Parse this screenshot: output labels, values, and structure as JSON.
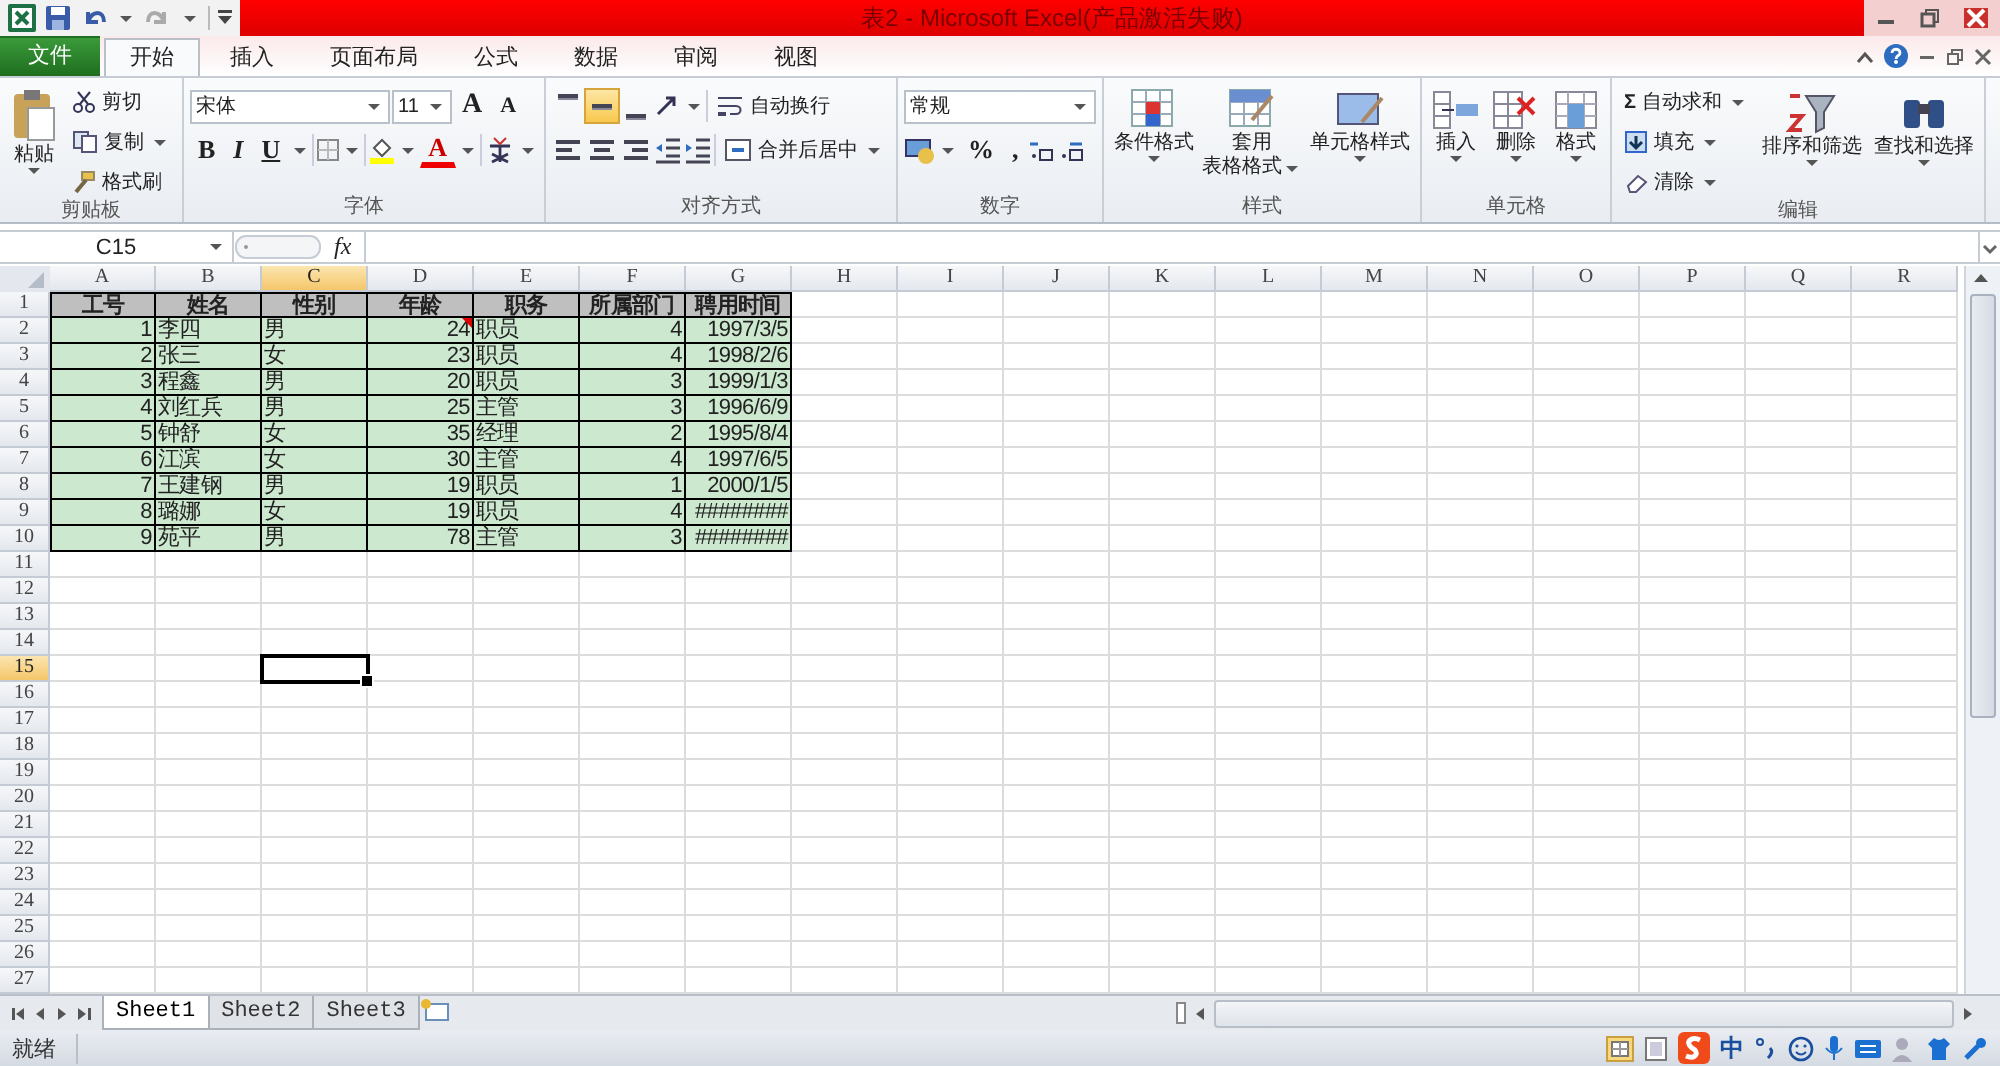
{
  "window": {
    "title": "表2 - Microsoft Excel(产品激活失败)"
  },
  "tabs": [
    {
      "label": "文件",
      "kind": "file",
      "selected": false
    },
    {
      "label": "开始",
      "kind": "tab",
      "selected": true
    },
    {
      "label": "插入",
      "kind": "tab",
      "selected": false
    },
    {
      "label": "页面布局",
      "kind": "tab",
      "selected": false
    },
    {
      "label": "公式",
      "kind": "tab",
      "selected": false
    },
    {
      "label": "数据",
      "kind": "tab",
      "selected": false
    },
    {
      "label": "审阅",
      "kind": "tab",
      "selected": false
    },
    {
      "label": "视图",
      "kind": "tab",
      "selected": false
    }
  ],
  "ribbon": {
    "clipboard": {
      "label": "剪贴板",
      "paste": "粘贴",
      "cut": "剪切",
      "copy": "复制",
      "format_painter": "格式刷"
    },
    "font": {
      "label": "字体",
      "font_name": "宋体",
      "font_size": "11",
      "grow": "A",
      "shrink": "A",
      "bold": "B",
      "italic": "I",
      "underline": "U",
      "font_color": "A"
    },
    "alignment": {
      "label": "对齐方式",
      "wrap_text": "自动换行",
      "merge_center": "合并后居中",
      "vertical_align": [
        {
          "selected": false
        },
        {
          "selected": true
        },
        {
          "selected": false
        }
      ]
    },
    "number": {
      "label": "数字",
      "format": "常规",
      "percent": "%",
      "comma": ","
    },
    "styles": {
      "label": "样式",
      "conditional": "条件格式",
      "table_format": [
        "套用",
        "表格格式"
      ],
      "cell_styles": "单元格样式"
    },
    "cells": {
      "label": "单元格",
      "insert": "插入",
      "delete": "删除",
      "format": "格式"
    },
    "editing": {
      "label": "编辑",
      "sigma": "Σ",
      "autosum": "自动求和",
      "fill": "填充",
      "clear": "清除",
      "sort_filter": "排序和筛选",
      "find_select": "查找和选择"
    }
  },
  "formula_bar": {
    "name_box": "C15",
    "fx": "fx"
  },
  "sheet": {
    "columns": [
      {
        "label": "A",
        "selected": false
      },
      {
        "label": "B",
        "selected": false
      },
      {
        "label": "C",
        "selected": true
      },
      {
        "label": "D",
        "selected": false
      },
      {
        "label": "E",
        "selected": false
      },
      {
        "label": "F",
        "selected": false
      },
      {
        "label": "G",
        "selected": false
      },
      {
        "label": "H",
        "selected": false
      },
      {
        "label": "I",
        "selected": false
      },
      {
        "label": "J",
        "selected": false
      },
      {
        "label": "K",
        "selected": false
      },
      {
        "label": "L",
        "selected": false
      },
      {
        "label": "M",
        "selected": false
      },
      {
        "label": "N",
        "selected": false
      },
      {
        "label": "O",
        "selected": false
      },
      {
        "label": "P",
        "selected": false
      },
      {
        "label": "Q",
        "selected": false
      },
      {
        "label": "R",
        "selected": false
      }
    ],
    "row_numbers": [
      {
        "label": "1",
        "selected": false
      },
      {
        "label": "2",
        "selected": false
      },
      {
        "label": "3",
        "selected": false
      },
      {
        "label": "4",
        "selected": false
      },
      {
        "label": "5",
        "selected": false
      },
      {
        "label": "6",
        "selected": false
      },
      {
        "label": "7",
        "selected": false
      },
      {
        "label": "8",
        "selected": false
      },
      {
        "label": "9",
        "selected": false
      },
      {
        "label": "10",
        "selected": false
      },
      {
        "label": "11",
        "selected": false
      },
      {
        "label": "12",
        "selected": false
      },
      {
        "label": "13",
        "selected": false
      },
      {
        "label": "14",
        "selected": false
      },
      {
        "label": "15",
        "selected": true
      },
      {
        "label": "16",
        "selected": false
      },
      {
        "label": "17",
        "selected": false
      },
      {
        "label": "18",
        "selected": false
      },
      {
        "label": "19",
        "selected": false
      },
      {
        "label": "20",
        "selected": false
      },
      {
        "label": "21",
        "selected": false
      },
      {
        "label": "22",
        "selected": false
      },
      {
        "label": "23",
        "selected": false
      },
      {
        "label": "24",
        "selected": false
      },
      {
        "label": "25",
        "selected": false
      },
      {
        "label": "26",
        "selected": false
      },
      {
        "label": "27",
        "selected": false
      }
    ],
    "rows": [
      {
        "kind": "header",
        "cells": [
          {
            "text": "工号",
            "comment": false
          },
          {
            "text": "姓名",
            "comment": false
          },
          {
            "text": "性别",
            "comment": false
          },
          {
            "text": "年龄",
            "comment": false
          },
          {
            "text": "职务",
            "comment": false
          },
          {
            "text": "所属部门",
            "comment": false
          },
          {
            "text": "聘用时间",
            "comment": false
          }
        ]
      },
      {
        "kind": "data",
        "cells": [
          {
            "text": "1",
            "kind": "number",
            "comment": false
          },
          {
            "text": "李四",
            "kind": "text",
            "comment": false
          },
          {
            "text": "男",
            "kind": "text",
            "comment": false
          },
          {
            "text": "24",
            "kind": "number",
            "comment": true
          },
          {
            "text": "职员",
            "kind": "text",
            "comment": false
          },
          {
            "text": "4",
            "kind": "number",
            "comment": false
          },
          {
            "text": "1997/3/5",
            "kind": "number",
            "comment": false
          }
        ]
      },
      {
        "kind": "data",
        "cells": [
          {
            "text": "2",
            "kind": "number",
            "comment": false
          },
          {
            "text": "张三",
            "kind": "text",
            "comment": false
          },
          {
            "text": "女",
            "kind": "text",
            "comment": false
          },
          {
            "text": "23",
            "kind": "number",
            "comment": false
          },
          {
            "text": "职员",
            "kind": "text",
            "comment": false
          },
          {
            "text": "4",
            "kind": "number",
            "comment": false
          },
          {
            "text": "1998/2/6",
            "kind": "number",
            "comment": false
          }
        ]
      },
      {
        "kind": "data",
        "cells": [
          {
            "text": "3",
            "kind": "number",
            "comment": false
          },
          {
            "text": "程鑫",
            "kind": "text",
            "comment": false
          },
          {
            "text": "男",
            "kind": "text",
            "comment": false
          },
          {
            "text": "20",
            "kind": "number",
            "comment": false
          },
          {
            "text": "职员",
            "kind": "text",
            "comment": false
          },
          {
            "text": "3",
            "kind": "number",
            "comment": false
          },
          {
            "text": "1999/1/3",
            "kind": "number",
            "comment": false
          }
        ]
      },
      {
        "kind": "data",
        "cells": [
          {
            "text": "4",
            "kind": "number",
            "comment": false
          },
          {
            "text": "刘红兵",
            "kind": "text",
            "comment": false
          },
          {
            "text": "男",
            "kind": "text",
            "comment": false
          },
          {
            "text": "25",
            "kind": "number",
            "comment": false
          },
          {
            "text": "主管",
            "kind": "text",
            "comment": false
          },
          {
            "text": "3",
            "kind": "number",
            "comment": false
          },
          {
            "text": "1996/6/9",
            "kind": "number",
            "comment": false
          }
        ]
      },
      {
        "kind": "data",
        "cells": [
          {
            "text": "5",
            "kind": "number",
            "comment": false
          },
          {
            "text": "钟舒",
            "kind": "text",
            "comment": false
          },
          {
            "text": "女",
            "kind": "text",
            "comment": false
          },
          {
            "text": "35",
            "kind": "number",
            "comment": false
          },
          {
            "text": "经理",
            "kind": "text",
            "comment": false
          },
          {
            "text": "2",
            "kind": "number",
            "comment": false
          },
          {
            "text": "1995/8/4",
            "kind": "number",
            "comment": false
          }
        ]
      },
      {
        "kind": "data",
        "cells": [
          {
            "text": "6",
            "kind": "number",
            "comment": false
          },
          {
            "text": "江滨",
            "kind": "text",
            "comment": false
          },
          {
            "text": "女",
            "kind": "text",
            "comment": false
          },
          {
            "text": "30",
            "kind": "number",
            "comment": false
          },
          {
            "text": "主管",
            "kind": "text",
            "comment": false
          },
          {
            "text": "4",
            "kind": "number",
            "comment": false
          },
          {
            "text": "1997/6/5",
            "kind": "number",
            "comment": false
          }
        ]
      },
      {
        "kind": "data",
        "cells": [
          {
            "text": "7",
            "kind": "number",
            "comment": false
          },
          {
            "text": "王建钢",
            "kind": "text",
            "comment": false
          },
          {
            "text": "男",
            "kind": "text",
            "comment": false
          },
          {
            "text": "19",
            "kind": "number",
            "comment": false
          },
          {
            "text": "职员",
            "kind": "text",
            "comment": false
          },
          {
            "text": "1",
            "kind": "number",
            "comment": false
          },
          {
            "text": "2000/1/5",
            "kind": "number",
            "comment": false
          }
        ]
      },
      {
        "kind": "data",
        "cells": [
          {
            "text": "8",
            "kind": "number",
            "comment": false
          },
          {
            "text": "璐娜",
            "kind": "text",
            "comment": false
          },
          {
            "text": "女",
            "kind": "text",
            "comment": false
          },
          {
            "text": "19",
            "kind": "number",
            "comment": false
          },
          {
            "text": "职员",
            "kind": "text",
            "comment": false
          },
          {
            "text": "4",
            "kind": "number",
            "comment": false
          },
          {
            "text": "########",
            "kind": "number",
            "comment": false
          }
        ]
      },
      {
        "kind": "data",
        "cells": [
          {
            "text": "9",
            "kind": "number",
            "comment": false
          },
          {
            "text": "苑平",
            "kind": "text",
            "comment": false
          },
          {
            "text": "男",
            "kind": "text",
            "comment": false
          },
          {
            "text": "78",
            "kind": "number",
            "comment": false
          },
          {
            "text": "主管",
            "kind": "text",
            "comment": false
          },
          {
            "text": "3",
            "kind": "number",
            "comment": false
          },
          {
            "text": "########",
            "kind": "number",
            "comment": false
          }
        ]
      }
    ]
  },
  "sheet_tabs": [
    {
      "label": "Sheet1",
      "selected": true
    },
    {
      "label": "Sheet2",
      "selected": false
    },
    {
      "label": "Sheet3",
      "selected": false
    }
  ],
  "status_bar": {
    "text": "就绪",
    "ime": "中"
  }
}
